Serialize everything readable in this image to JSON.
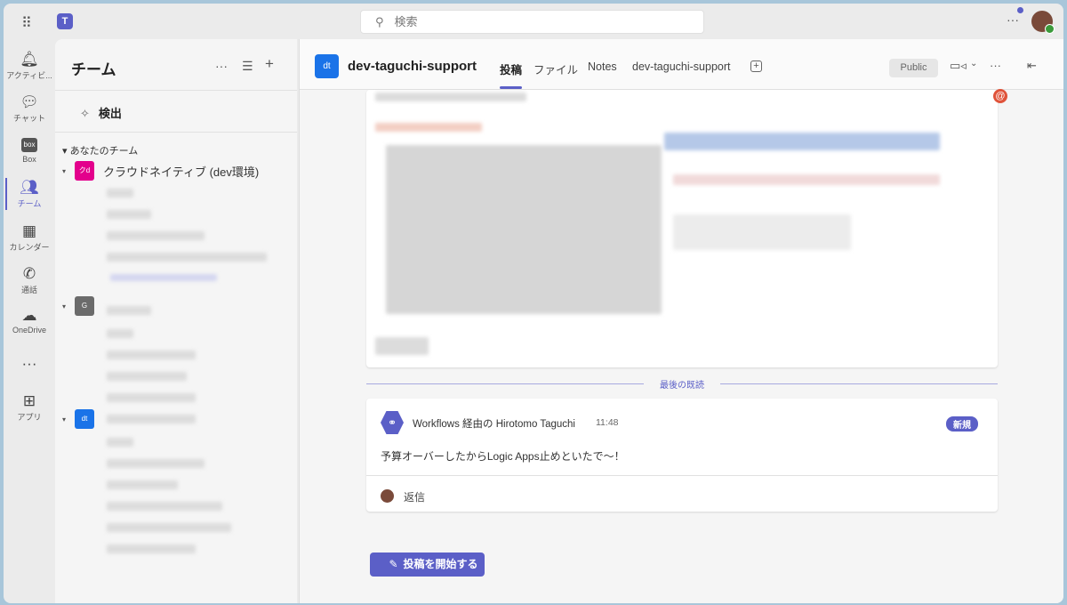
{
  "topbar": {
    "search_placeholder": "検索",
    "search_icon": "⚲",
    "more": "···",
    "apps_icon": "⋮⋮⋮",
    "teams_logo": "T"
  },
  "rail": [
    {
      "label": "アクティビ...",
      "icon": "🔔︎"
    },
    {
      "label": "チャット",
      "icon": "💬︎"
    },
    {
      "label": "Box",
      "icon": "box"
    },
    {
      "label": "チーム",
      "icon": "👥︎"
    },
    {
      "label": "カレンダー",
      "icon": "▦"
    },
    {
      "label": "通話",
      "icon": "✆"
    },
    {
      "label": "OneDrive",
      "icon": "☁"
    },
    {
      "label": "",
      "icon": "···"
    },
    {
      "label": "アプリ",
      "icon": "⊞"
    }
  ],
  "panel": {
    "title": "チーム",
    "more": "···",
    "filter": "☰",
    "add": "+",
    "discover": "検出",
    "discover_icon": "✧",
    "section": "あなたのチーム",
    "teams": [
      {
        "abbr": "クd",
        "name": "クラウドネイティブ (dev環境)",
        "color": "#e3008c"
      },
      {
        "abbr": "G",
        "name": "",
        "color": "#6b6b6b"
      },
      {
        "abbr": "dt",
        "name": "",
        "color": "#1a73e8"
      }
    ]
  },
  "channel": {
    "abbr": "dt",
    "name": "dev-taguchi-support",
    "tabs": [
      "投稿",
      "ファイル",
      "Notes",
      "dev-taguchi-support"
    ],
    "add_tab": "+",
    "visibility": "Public",
    "video": "▭◃",
    "chev": "⌄",
    "more": "···",
    "panel": "⇤"
  },
  "feed": {
    "last_read": "最後の既読",
    "mention": "@",
    "message": {
      "sender": "Workflows 経由の Hirotomo Taguchi",
      "time": "11:48",
      "badge": "新規",
      "body": "予算オーバーしたからLogic Apps止めといたで〜！",
      "reply": "返信"
    },
    "new_post": "投稿を開始する",
    "new_post_icon": "✎"
  }
}
